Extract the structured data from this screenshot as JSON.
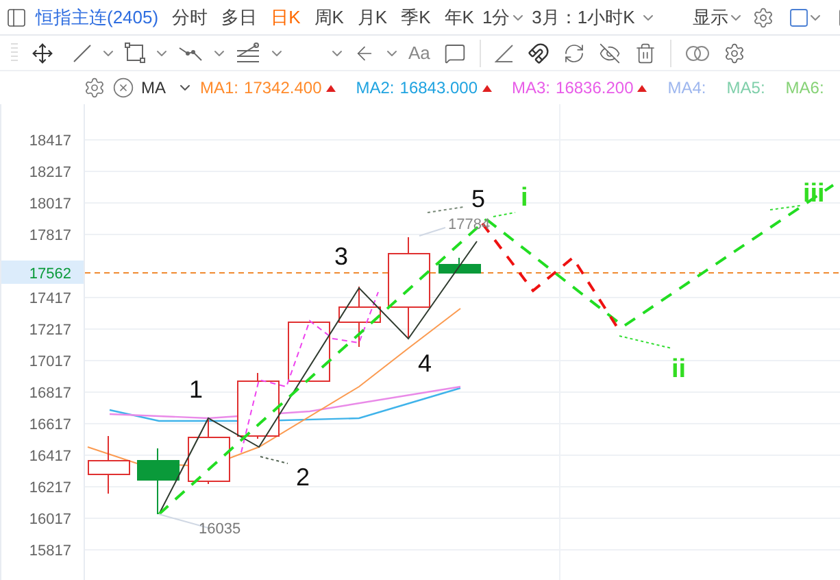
{
  "top_bar": {
    "symbol": "恒指主连(2405)",
    "tabs": [
      {
        "label": "分时",
        "selected": false
      },
      {
        "label": "多日",
        "selected": false
      },
      {
        "label": "日K",
        "selected": true
      },
      {
        "label": "周K",
        "selected": false
      },
      {
        "label": "月K",
        "selected": false
      },
      {
        "label": "季K",
        "selected": false
      },
      {
        "label": "年K",
        "selected": false
      }
    ],
    "interval": "1分",
    "period": "3月：1小时K",
    "display": "显示"
  },
  "toolbar": {
    "text_tool": "Aa"
  },
  "indicator": {
    "name": "MA",
    "lines": [
      {
        "label": "MA1:",
        "value": "17342.400",
        "color": "#ff8a2a",
        "up": true
      },
      {
        "label": "MA2:",
        "value": "16843.000",
        "color": "#1fa3e0",
        "up": true
      },
      {
        "label": "MA3:",
        "value": "16836.200",
        "color": "#e85ce8",
        "up": true
      },
      {
        "label": "MA4:",
        "color": "#9db6ee",
        "up": false
      },
      {
        "label": "MA5:",
        "color": "#7fcfaa",
        "up": false
      },
      {
        "label": "MA6:",
        "color": "#86d276",
        "up": false
      }
    ]
  },
  "chart": {
    "y_ticks": [
      "18417",
      "18217",
      "18017",
      "17817",
      "17417",
      "17217",
      "17017",
      "16817",
      "16617",
      "16417",
      "16217",
      "16017",
      "15817"
    ],
    "current_price": "17562",
    "low_label": "16035",
    "high_label": "17784",
    "wave_labels": [
      {
        "text": "1",
        "kind": "impulse"
      },
      {
        "text": "2",
        "kind": "impulse"
      },
      {
        "text": "3",
        "kind": "impulse"
      },
      {
        "text": "4",
        "kind": "impulse"
      },
      {
        "text": "5",
        "kind": "impulse"
      },
      {
        "text": "i",
        "kind": "forecast"
      },
      {
        "text": "ii",
        "kind": "forecast"
      },
      {
        "text": "iii",
        "kind": "forecast"
      }
    ]
  }
}
